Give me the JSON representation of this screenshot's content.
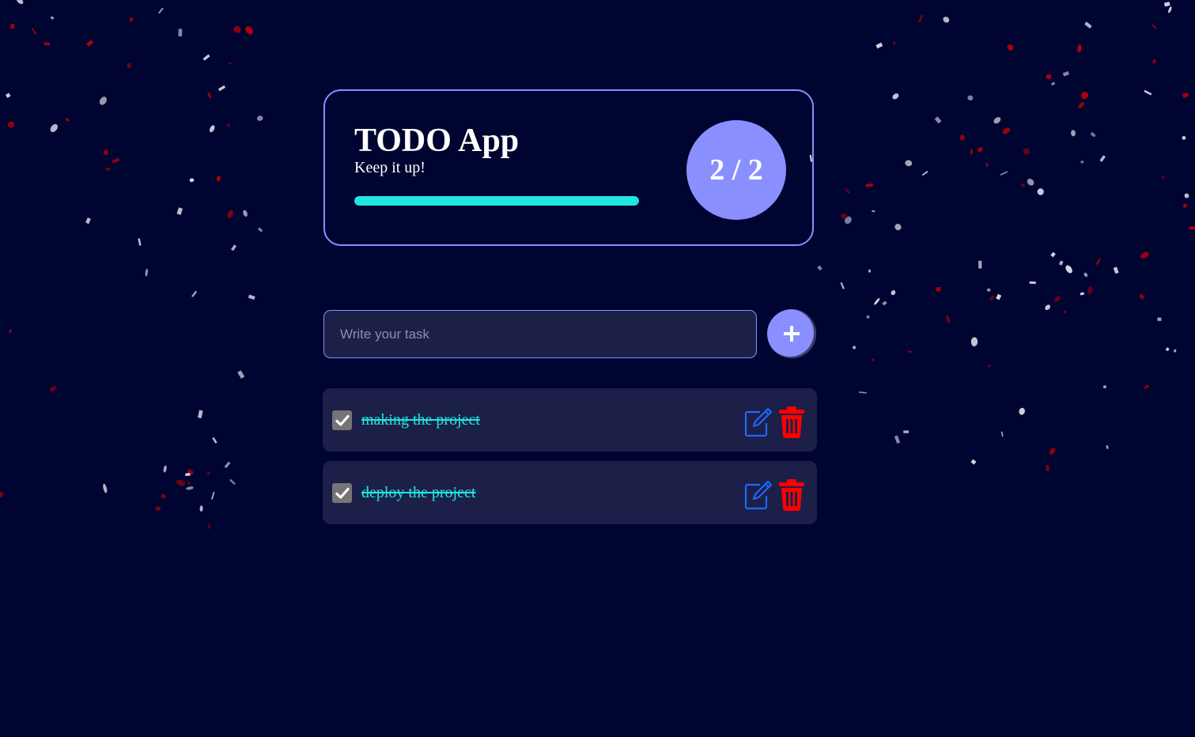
{
  "app": {
    "title": "TODO App",
    "subtitle": "Keep it up!",
    "completed_count": 2,
    "total_count": 2,
    "stats_text": "2 / 2",
    "progress_fraction": 1.0
  },
  "input": {
    "placeholder": "Write your task",
    "value": ""
  },
  "add_button": {
    "icon": "plus-icon"
  },
  "tasks": [
    {
      "text": "making the project",
      "completed": true,
      "edit_icon": "pencil-square-icon",
      "delete_icon": "trash-icon"
    },
    {
      "text": "deploy the project",
      "completed": true,
      "edit_icon": "pencil-square-icon",
      "delete_icon": "trash-icon"
    }
  ],
  "colors": {
    "background": "#000430",
    "accent": "#8a8fff",
    "progress": "#22e5df",
    "task_text": "#22e5df",
    "card_bg": "#1c1f48",
    "edit_icon": "#1e66ff",
    "delete_icon": "#ff0000",
    "checkbox": "#757577",
    "confetti_red": "#b0000a",
    "confetti_white": "#d8d9e6"
  }
}
